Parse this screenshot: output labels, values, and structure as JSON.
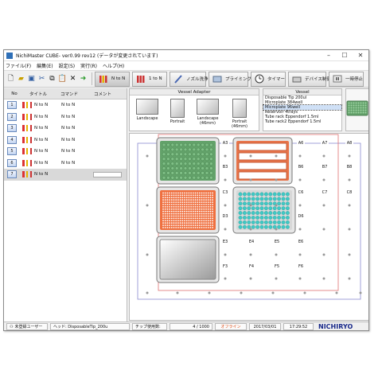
{
  "window": {
    "title": "NichiMaster CUBE-  ver0.99 rev12 (データが変更されています)"
  },
  "menu": [
    "ファイル(F)",
    "編集(E)",
    "設定(S)",
    "実行(R)",
    "ヘルプ(H)"
  ],
  "toolbar": {
    "buttons": [
      "N to N",
      "1 to N",
      "ノズル洗浄",
      "プライミング",
      "タイマー",
      "デバイス制御",
      "一時停止"
    ]
  },
  "list": {
    "headers": [
      "No",
      "タイトル",
      "コマンド",
      "コメント"
    ],
    "rows": [
      {
        "no": "1",
        "title": "N to N",
        "command": "N to N",
        "comment": ""
      },
      {
        "no": "2",
        "title": "N to N",
        "command": "N to N",
        "comment": ""
      },
      {
        "no": "3",
        "title": "N to N",
        "command": "N to N",
        "comment": ""
      },
      {
        "no": "4",
        "title": "N to N",
        "command": "N to N",
        "comment": ""
      },
      {
        "no": "5",
        "title": "N to N",
        "command": "N to N",
        "comment": ""
      },
      {
        "no": "6",
        "title": "N to N",
        "command": "N to N",
        "comment": ""
      },
      {
        "no": "7",
        "title": "N to N",
        "command": "",
        "comment": ""
      }
    ]
  },
  "adapter": {
    "title": "Vessel Adapter",
    "items": [
      "Landscape",
      "Portrait",
      "Landscape (46mm)",
      "Portrait (46mm)"
    ]
  },
  "vessel": {
    "title": "Vessel",
    "items": [
      "Disposable Tip 200ul",
      "Microplate 384well",
      "Microplate 96well",
      "Reservoir 4trays",
      "Tube rack Eppendorf 1.5ml",
      "Tube rack2 Eppendorf 1.5ml"
    ],
    "selected_index": 2
  },
  "deck": {
    "labels": [
      "A3",
      "A6",
      "A7",
      "A8",
      "B3",
      "B6",
      "B7",
      "B8",
      "C3",
      "C6",
      "C7",
      "C8",
      "D3",
      "D6",
      "E3",
      "E4",
      "E5",
      "E6",
      "F3",
      "F4",
      "F5",
      "F6"
    ]
  },
  "status": {
    "user": "未登録ユーザー",
    "head": "ヘッド: DisposableTip_200u",
    "tip_label": "チップ使用数:",
    "tip_count": "4 / 1000",
    "online": "オフライン",
    "date": "2017/03/01",
    "time": "17:29:52",
    "brand": "NICHIRYO"
  },
  "colors": {
    "green_plate": "#63a26a",
    "orange_plate": "#ef7040",
    "reservoir": "#e8744a",
    "cyan_wells": "#3ec9c5",
    "offline_text": "#e0501a"
  }
}
